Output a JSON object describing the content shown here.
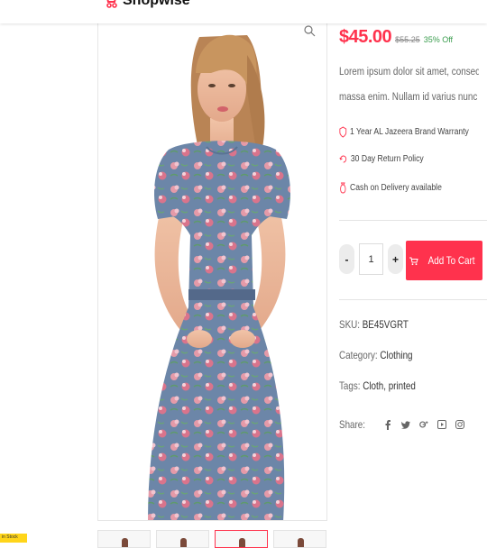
{
  "header": {
    "brand": "Shopwise"
  },
  "gallery": {
    "thumbnails": [
      {
        "active": false
      },
      {
        "active": false
      },
      {
        "active": true
      },
      {
        "active": false
      }
    ]
  },
  "badge": {
    "text": "in Stock"
  },
  "product": {
    "price": "$45.00",
    "old_price": "$55.25",
    "discount": "35% Off",
    "description_line1": "Lorem ipsum dolor sit amet, consectetur adipiscing",
    "description_line2": "massa enim. Nullam id varius nunc id varius nunc",
    "features": [
      {
        "icon": "shield-icon",
        "text": "1 Year AL Jazeera Brand Warranty"
      },
      {
        "icon": "refresh-icon",
        "text": "30 Day Return Policy"
      },
      {
        "icon": "cash-bag-icon",
        "text": "Cash on Delivery available"
      }
    ],
    "quantity": "1",
    "minus_label": "-",
    "plus_label": "+",
    "add_to_cart": "Add To Cart",
    "sku_label": "SKU:",
    "sku_value": "BE45VGRT",
    "category_label": "Category:",
    "category_value": "Clothing",
    "tags_label": "Tags:",
    "tags_value": "Cloth, printed",
    "share_label": "Share:",
    "share_icons": [
      "facebook-icon",
      "twitter-icon",
      "google-plus-icon",
      "youtube-icon",
      "instagram-icon"
    ]
  },
  "colors": {
    "accent": "#ff324d",
    "discount": "#3b9d4f"
  }
}
